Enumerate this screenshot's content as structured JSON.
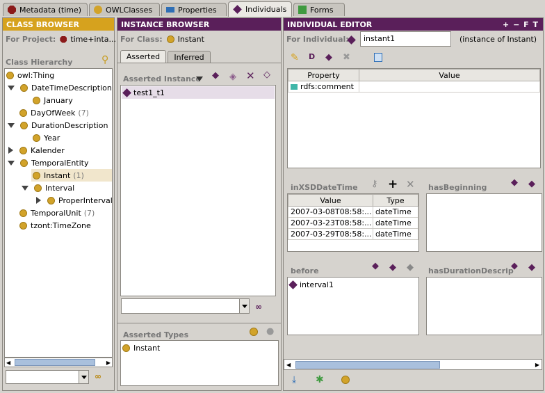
{
  "tabs": [
    {
      "label": "Metadata (time)",
      "icon": "metadata-icon"
    },
    {
      "label": "OWLClasses",
      "icon": "owlclasses-icon"
    },
    {
      "label": "Properties",
      "icon": "properties-icon"
    },
    {
      "label": "Individuals",
      "icon": "individuals-icon"
    },
    {
      "label": "Forms",
      "icon": "forms-icon"
    }
  ],
  "class_browser": {
    "title": "CLASS BROWSER",
    "for_project_label": "For Project:",
    "project": "time+inta...",
    "hierarchy_label": "Class Hierarchy",
    "items": [
      {
        "label": "owl:Thing",
        "count": ""
      },
      {
        "label": "DateTimeDescription",
        "count": ""
      },
      {
        "label": "January",
        "count": ""
      },
      {
        "label": "DayOfWeek",
        "count": "(7)"
      },
      {
        "label": "DurationDescription",
        "count": ""
      },
      {
        "label": "Year",
        "count": ""
      },
      {
        "label": "Kalender",
        "count": ""
      },
      {
        "label": "TemporalEntity",
        "count": ""
      },
      {
        "label": "Instant",
        "count": "(1)"
      },
      {
        "label": "Interval",
        "count": ""
      },
      {
        "label": "ProperInterval",
        "count": ""
      },
      {
        "label": "TemporalUnit",
        "count": "(7)"
      },
      {
        "label": "tzont:TimeZone",
        "count": ""
      }
    ]
  },
  "instance_browser": {
    "title": "INSTANCE BROWSER",
    "for_class_label": "For Class:",
    "class": "Instant",
    "tab_asserted": "Asserted",
    "tab_inferred": "Inferred",
    "asserted_instance_label": "Asserted Instance",
    "instances": [
      "test1_t1"
    ],
    "asserted_types_label": "Asserted Types",
    "types": [
      "Instant"
    ]
  },
  "individual_editor": {
    "title": "INDIVIDUAL EDITOR",
    "title_controls": "+ − F T",
    "for_individual_label": "For Individual:",
    "individual": "instant1",
    "instance_of": "(instance of Instant)",
    "prop_headers": {
      "property": "Property",
      "value": "Value"
    },
    "properties": [
      {
        "name": "rdfs:comment",
        "value": ""
      }
    ],
    "inxsd_label": "inXSDDateTime",
    "inxsd_headers": {
      "value": "Value",
      "type": "Type"
    },
    "inxsd_rows": [
      {
        "value": "2007-03-08T08:58:...",
        "type": "dateTime"
      },
      {
        "value": "2007-03-23T08:58:...",
        "type": "dateTime"
      },
      {
        "value": "2007-03-29T08:58:...",
        "type": "dateTime"
      }
    ],
    "has_beginning_label": "hasBeginning",
    "before_label": "before",
    "before_items": [
      "interval1"
    ],
    "has_duration_label": "hasDurationDescrip"
  },
  "colors": {
    "gold_header": "#d6a21e",
    "purple_header": "#5a1f5a",
    "selection": "#e6dde8"
  }
}
